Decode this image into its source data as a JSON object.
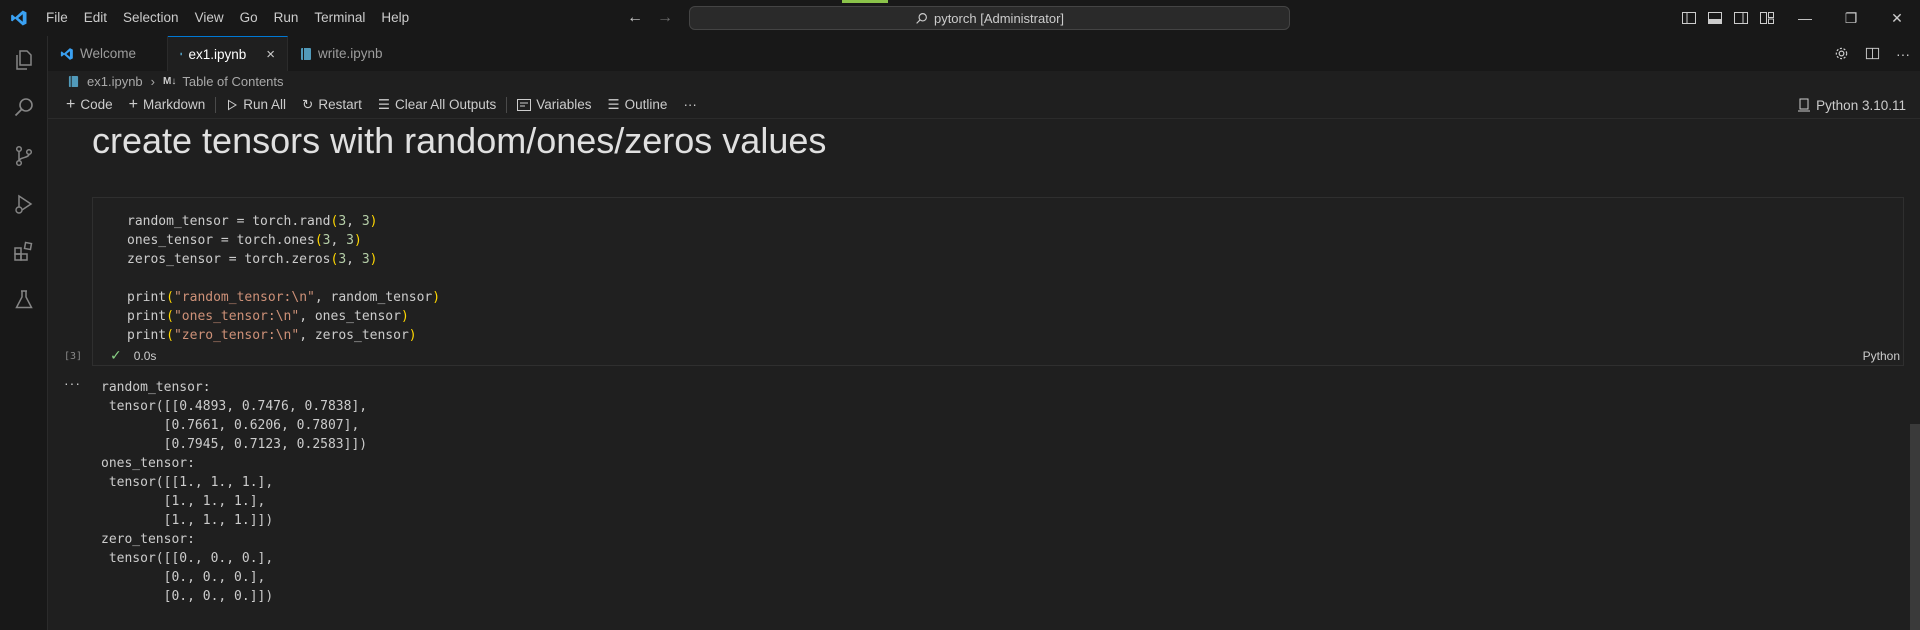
{
  "menu": [
    "File",
    "Edit",
    "Selection",
    "View",
    "Go",
    "Run",
    "Terminal",
    "Help"
  ],
  "command_center": {
    "label": "pytorch [Administrator]"
  },
  "tabs": [
    {
      "label": "Welcome",
      "icon": "vscode-logo-icon"
    },
    {
      "label": "ex1.ipynb",
      "icon": "notebook-icon",
      "close": "×"
    },
    {
      "label": "write.ipynb",
      "icon": "notebook-icon"
    }
  ],
  "breadcrumb": {
    "file": "ex1.ipynb",
    "md_badge": "M↓",
    "section": "Table of Contents"
  },
  "toolbar": {
    "code": "Code",
    "markdown": "Markdown",
    "run_all": "Run All",
    "restart": "Restart",
    "clear_outputs": "Clear All Outputs",
    "variables": "Variables",
    "outline": "Outline",
    "more": "···",
    "kernel": "Python 3.10.11"
  },
  "heading": "create tensors with random/ones/zeros values",
  "cell": {
    "exec_count": "[3]",
    "duration": "0.0s",
    "language": "Python",
    "output_more": "···"
  },
  "output": [
    "random_tensor:",
    " tensor([[0.4893, 0.7476, 0.7838],",
    "        [0.7661, 0.6206, 0.7807],",
    "        [0.7945, 0.7123, 0.2583]])",
    "ones_tensor:",
    " tensor([[1., 1., 1.],",
    "        [1., 1., 1.],",
    "        [1., 1., 1.]])",
    "zero_tensor:",
    " tensor([[0., 0., 0.],",
    "        [0., 0., 0.],",
    "        [0., 0., 0.]])"
  ],
  "colors": {
    "accent": "#0078d4",
    "string": "#ce9178",
    "number": "#b5cea8",
    "paren": "#ffd700",
    "success": "#89d185"
  }
}
